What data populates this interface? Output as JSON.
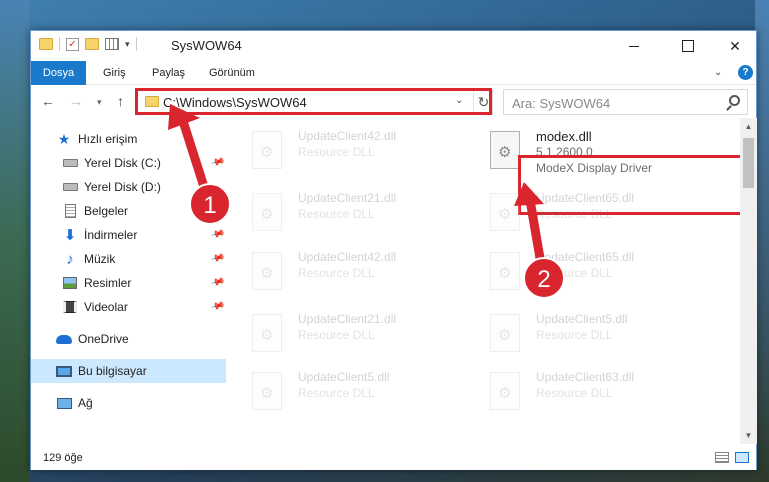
{
  "window": {
    "title": "SysWOW64"
  },
  "ribbon": {
    "tabs": [
      "Dosya",
      "Giriş",
      "Paylaş",
      "Görünüm"
    ]
  },
  "address": {
    "path": "C:\\Windows\\SysWOW64",
    "search_placeholder": "Ara: SysWOW64"
  },
  "navpane": {
    "items": [
      {
        "label": "Hızlı erişim",
        "icon": "star-icon",
        "pinned": false
      },
      {
        "label": "Yerel Disk (C:)",
        "icon": "drive-icon",
        "pinned": true
      },
      {
        "label": "Yerel Disk (D:)",
        "icon": "drive-icon",
        "pinned": false
      },
      {
        "label": "Belgeler",
        "icon": "documents-icon",
        "pinned": true
      },
      {
        "label": "İndirmeler",
        "icon": "download-icon",
        "pinned": true
      },
      {
        "label": "Müzik",
        "icon": "music-icon",
        "pinned": true
      },
      {
        "label": "Resimler",
        "icon": "pictures-icon",
        "pinned": true
      },
      {
        "label": "Videolar",
        "icon": "videos-icon",
        "pinned": true
      },
      {
        "label": "OneDrive",
        "icon": "cloud-icon",
        "pinned": false
      },
      {
        "label": "Bu bilgisayar",
        "icon": "computer-icon",
        "pinned": false,
        "selected": true
      },
      {
        "label": "Ağ",
        "icon": "network-icon",
        "pinned": false
      }
    ]
  },
  "files": {
    "col1": [
      {
        "name": "UpdateClient42.dll",
        "type": "Resource DLL"
      },
      {
        "name": "UpdateClient21.dll",
        "type": "Resource DLL"
      },
      {
        "name": "UpdateClient42.dll",
        "type": "Resource DLL"
      },
      {
        "name": "UpdateClient21.dll",
        "type": "Resource DLL"
      },
      {
        "name": "UpdateClient5.dll",
        "type": "Resource DLL"
      }
    ],
    "highlighted": {
      "name": "modex.dll",
      "version": "5.1.2600.0",
      "description": "ModeX Display Driver"
    },
    "col2": [
      {
        "name": "UpdateClient65.dll",
        "type": "Resource DLL"
      },
      {
        "name": "UpdateClient65.dll",
        "type": "Resource DLL"
      },
      {
        "name": "UpdateClient5.dll",
        "type": "Resource DLL"
      },
      {
        "name": "UpdateClient63.dll",
        "type": "Resource DLL"
      }
    ]
  },
  "status": {
    "item_count": "129 öğe"
  },
  "annotations": {
    "step1": "1",
    "step2": "2",
    "color": "#d9262e"
  }
}
